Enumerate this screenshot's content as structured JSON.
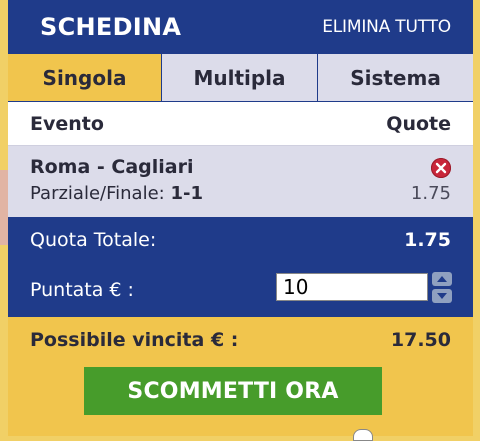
{
  "header": {
    "title": "SCHEDINA",
    "clear_all": "ELIMINA TUTTO"
  },
  "tabs": [
    {
      "label": "Singola",
      "active": true
    },
    {
      "label": "Multipla",
      "active": false
    },
    {
      "label": "Sistema",
      "active": false
    }
  ],
  "columns": {
    "event": "Evento",
    "odds": "Quote"
  },
  "selection": {
    "match": "Roma - Cagliari",
    "market_label": "Parziale/Finale: ",
    "market_value": "1-1",
    "odds": "1.75",
    "remove_icon": "close-circle-icon"
  },
  "summary": {
    "total_odds_label": "Quota Totale:",
    "total_odds_value": "1.75",
    "stake_label": "Puntata € :",
    "stake_value": "10",
    "possible_win_label": "Possibile vincita € :",
    "possible_win_value": "17.50"
  },
  "actions": {
    "bet_button": "SCOMMETTI ORA"
  },
  "colors": {
    "header_blue": "#1f3b8a",
    "panel_yellow": "#f1c54d",
    "tab_inactive": "#dcdcea",
    "bet_green": "#479c2b",
    "remove_red": "#c8263a"
  }
}
